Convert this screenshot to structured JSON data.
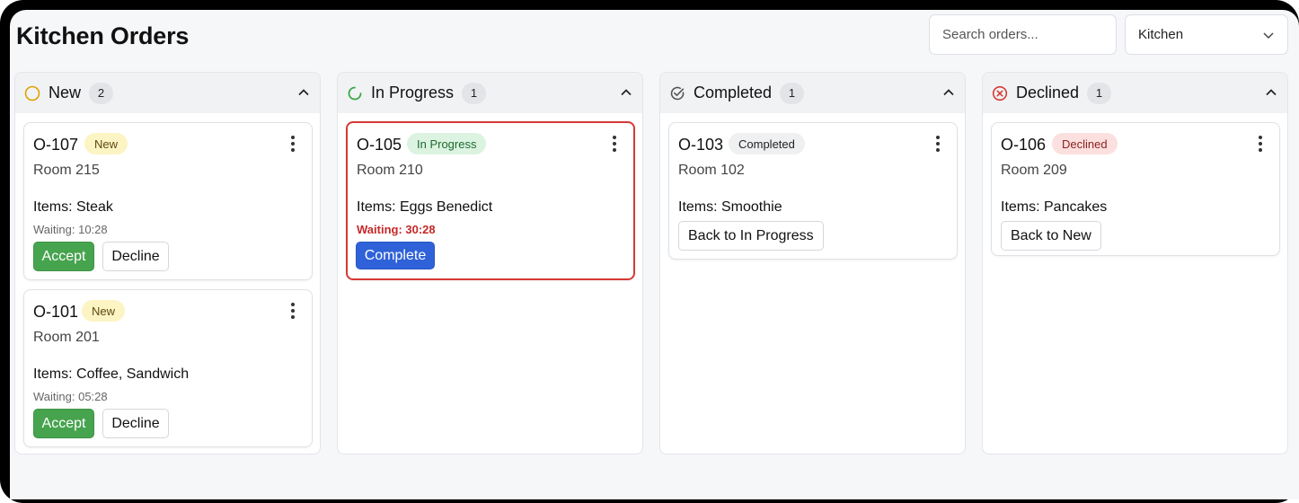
{
  "header": {
    "title": "Kitchen Orders",
    "search_placeholder": "Search orders...",
    "filter_value": "Kitchen"
  },
  "columns": [
    {
      "title": "New",
      "count": "2",
      "icon": "circle-outline-icon",
      "icon_color": "#e0a100",
      "cards": [
        {
          "id": "O-107",
          "status": "New",
          "room": "Room 215",
          "items": "Items: Steak",
          "waiting": "Waiting: 10:28",
          "actions": [
            "Accept",
            "Decline"
          ]
        },
        {
          "id": "O-101",
          "status": "New",
          "room": "Room 201",
          "items": "Items: Coffee, Sandwich",
          "waiting": "Waiting: 05:28",
          "actions": [
            "Accept",
            "Decline"
          ]
        }
      ]
    },
    {
      "title": "In Progress",
      "count": "1",
      "icon": "progress-spinner-icon",
      "icon_color": "#3aa845",
      "cards": [
        {
          "id": "O-105",
          "status": "In Progress",
          "room": "Room 210",
          "items": "Items: Eggs Benedict",
          "waiting": "Waiting: 30:28",
          "actions": [
            "Complete"
          ]
        }
      ]
    },
    {
      "title": "Completed",
      "count": "1",
      "icon": "check-circle-icon",
      "icon_color": "#555555",
      "cards": [
        {
          "id": "O-103",
          "status": "Completed",
          "room": "Room 102",
          "items": "Items: Smoothie",
          "actions": [
            "Back to In Progress"
          ]
        }
      ]
    },
    {
      "title": "Declined",
      "count": "1",
      "icon": "x-circle-icon",
      "icon_color": "#d63a35",
      "cards": [
        {
          "id": "O-106",
          "status": "Declined",
          "room": "Room 209",
          "items": "Items: Pancakes",
          "actions": [
            "Back to New"
          ]
        }
      ]
    }
  ],
  "colors": {
    "accept": "#46a34e",
    "complete": "#2f62d8",
    "overdue_border": "#d63a35"
  }
}
